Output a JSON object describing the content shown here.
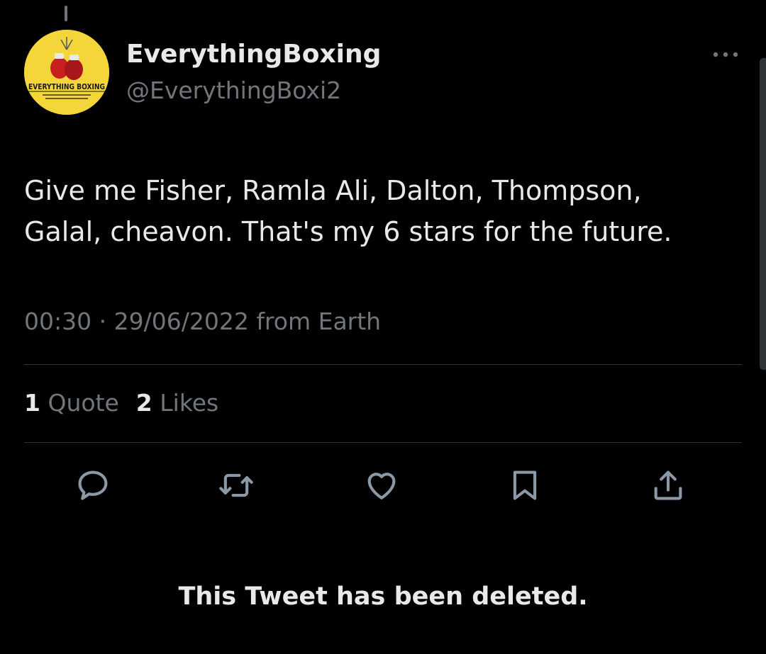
{
  "tweet": {
    "author": {
      "display_name": "EverythingBoxing",
      "handle": "@EverythingBoxi2",
      "avatar_text": "EVERYTHING BOXING"
    },
    "text_line1": "Give me Fisher, Ramla Ali, Dalton, Thompson,",
    "text_line2": "Galal, cheavon. That's my 6 stars for the future.",
    "time": "00:30",
    "date": "29/06/2022",
    "source": "from Earth",
    "separator": "·",
    "quotes_count": "1",
    "quotes_label": "Quote",
    "likes_count": "2",
    "likes_label": "Likes"
  },
  "actions": {
    "reply_icon": "reply-icon",
    "retweet_icon": "retweet-icon",
    "like_icon": "heart-icon",
    "bookmark_icon": "bookmark-icon",
    "share_icon": "share-icon"
  },
  "notice": "This Tweet has been deleted.",
  "colors": {
    "background": "#000000",
    "primary_text": "#e7e9ea",
    "secondary_text": "#71767b",
    "divider": "#2f3336",
    "avatar_bg": "#f5d63a"
  }
}
